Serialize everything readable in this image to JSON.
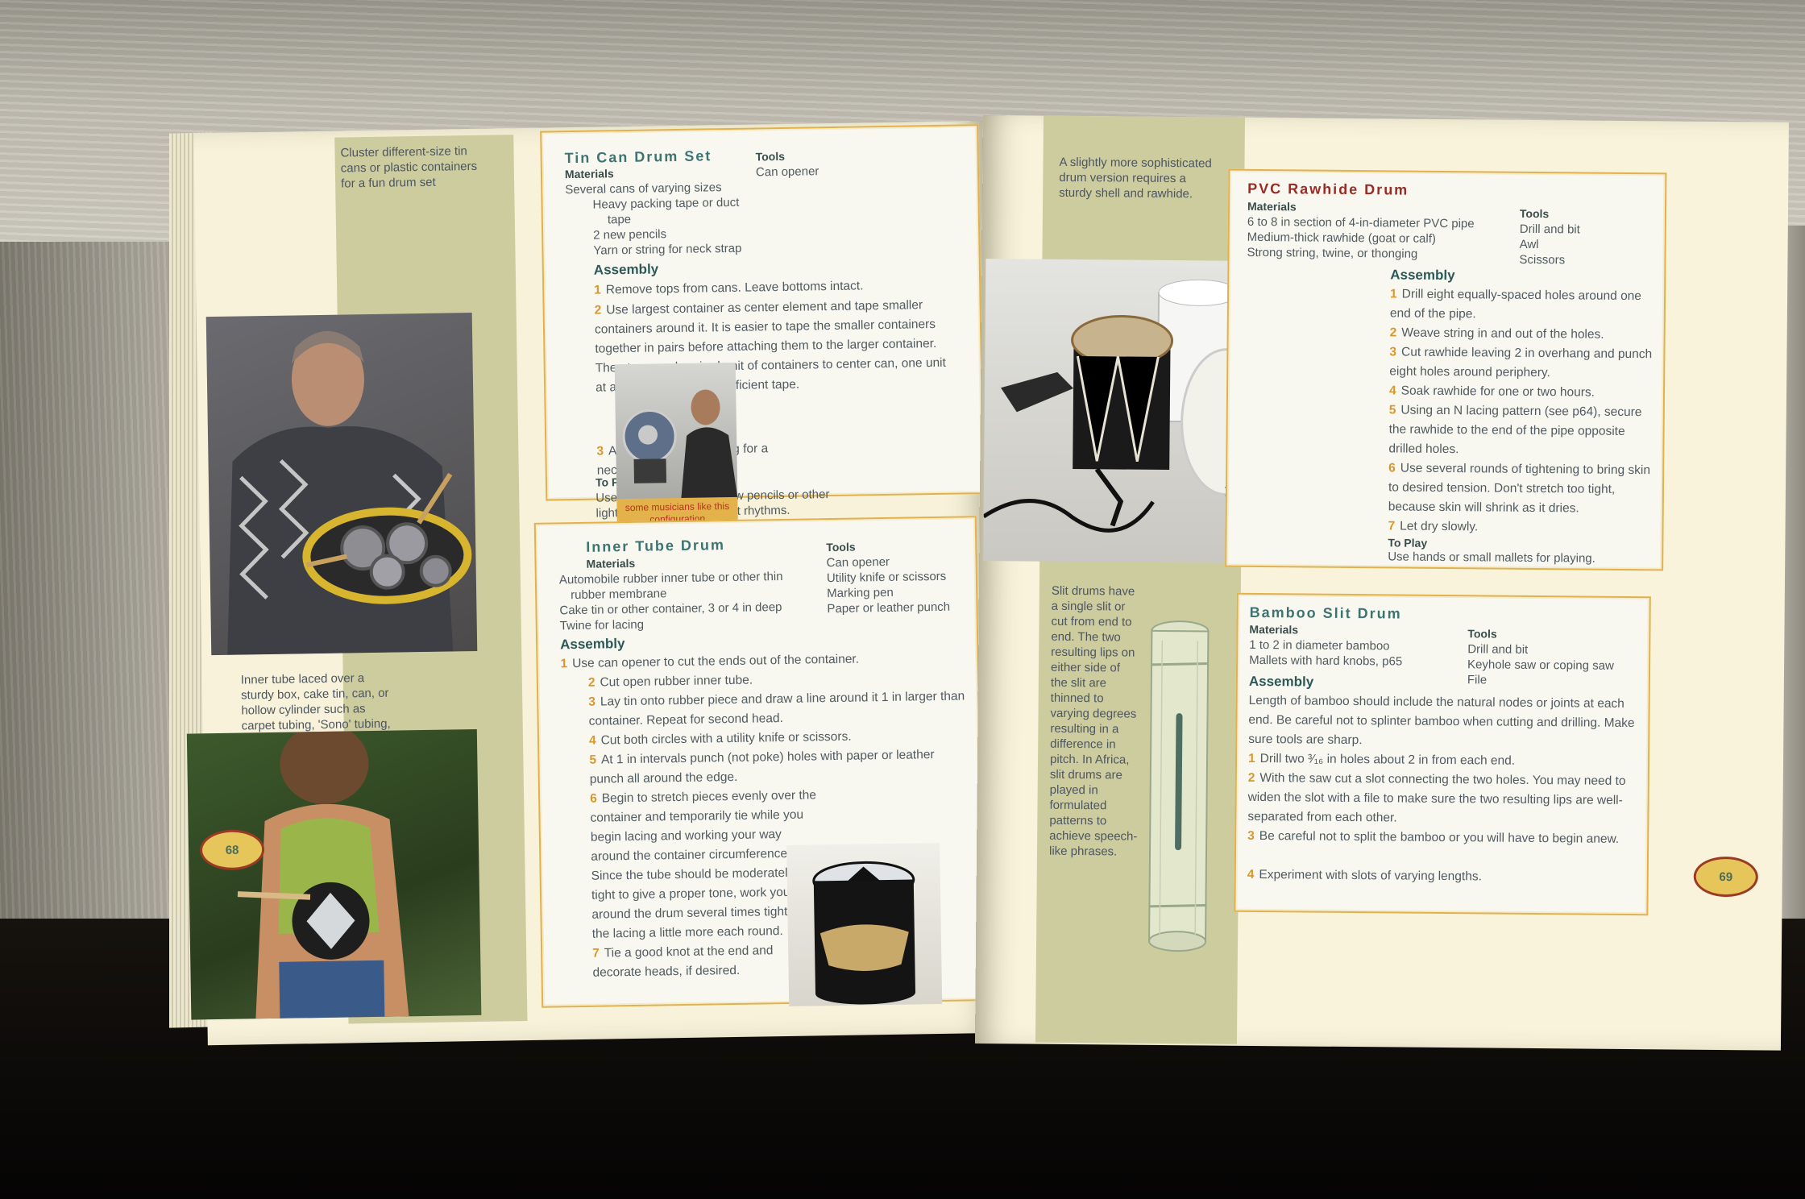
{
  "left_page": {
    "page_number": "68",
    "tin_can": {
      "caption": "Cluster different-size tin cans or plastic containers for a fun drum set",
      "title": "Tin Can Drum Set",
      "materials_label": "Materials",
      "materials": [
        "Several cans of varying sizes",
        "Heavy packing tape or duct",
        "tape",
        "2 new pencils",
        "Yarn or string for neck strap"
      ],
      "tools_label": "Tools",
      "tools": [
        "Can opener"
      ],
      "assembly_label": "Assembly",
      "steps": [
        {
          "n": "1",
          "text": "Remove tops from cans. Leave bottoms intact."
        },
        {
          "n": "2",
          "text": "Use largest container as center element and tape smaller containers around it. It is easier to tape the smaller containers together in pairs before attaching them to the larger container. Then tape each paired unit of containers to center can, one unit at a time. Secure with sufficient tape."
        },
        {
          "n": "3",
          "text": "Attach a length of string for a neck strap."
        }
      ],
      "to_play_label": "To Play",
      "to_play": "Use the eraser ends of new pencils or other lightweight sticks to tap out rhythms.",
      "photo_caption": "some musicians like this configuration"
    },
    "inner_tube": {
      "caption": "Inner tube laced over a sturdy box, cake tin, can, or hollow cylinder such as carpet tubing, 'Sono' tubing, large diameter pipes, or hollow logs make an effective drum.",
      "title": "Inner Tube Drum",
      "materials_label": "Materials",
      "materials": [
        "Automobile rubber inner tube or other thin",
        "rubber membrane",
        "Cake tin or other container, 3 or 4 in deep",
        "Twine for lacing"
      ],
      "tools_label": "Tools",
      "tools": [
        "Can opener",
        "Utility knife or scissors",
        "Marking pen",
        "Paper or leather punch"
      ],
      "assembly_label": "Assembly",
      "steps": [
        {
          "n": "1",
          "text": "Use can opener to cut the ends out of the container."
        },
        {
          "n": "2",
          "text": "Cut open rubber inner tube."
        },
        {
          "n": "3",
          "text": "Lay tin onto rubber piece and draw a line around it 1 in larger than container. Repeat for second head."
        },
        {
          "n": "4",
          "text": "Cut both circles with a utility knife or scissors."
        },
        {
          "n": "5",
          "text": "At 1 in intervals punch (not poke) holes with paper or leather punch all around the edge."
        },
        {
          "n": "6",
          "text": "Begin to stretch pieces evenly over the container and temporarily tie while you begin lacing and working your way around the container circumference. Since the tube should be moderately tight to give a proper tone, work your way around the drum several times tightening the lacing a little more each round."
        },
        {
          "n": "7",
          "text": "Tie a good knot at the end and decorate heads, if desired."
        }
      ]
    }
  },
  "right_page": {
    "page_number": "69",
    "pvc": {
      "caption": "A slightly more sophisticated drum version requires a sturdy shell and rawhide.",
      "title": "PVC Rawhide Drum",
      "materials_label": "Materials",
      "materials": [
        "6 to 8 in section of 4-in-diameter PVC pipe",
        "Medium-thick rawhide (goat or calf)",
        "Strong string, twine, or thonging"
      ],
      "tools_label": "Tools",
      "tools": [
        "Drill and bit",
        "Awl",
        "Scissors"
      ],
      "assembly_label": "Assembly",
      "steps": [
        {
          "n": "1",
          "text": "Drill eight equally-spaced holes around one end of the pipe."
        },
        {
          "n": "2",
          "text": "Weave string in and out of the holes."
        },
        {
          "n": "3",
          "text": "Cut rawhide leaving 2 in overhang and punch eight holes around periphery."
        },
        {
          "n": "4",
          "text": "Soak rawhide for one or two hours."
        },
        {
          "n": "5",
          "text": "Using an N lacing pattern (see p64), secure the rawhide to the end of the pipe opposite drilled holes."
        },
        {
          "n": "6",
          "text": "Use several rounds of tightening to bring skin to desired tension. Don't stretch too tight, because skin will shrink as it dries."
        },
        {
          "n": "7",
          "text": "Let dry slowly."
        }
      ],
      "to_play_label": "To Play",
      "to_play": "Use hands or small mallets for playing."
    },
    "bamboo": {
      "caption": "Slit drums have a single slit or cut from end to end. The two resulting lips on either side of the slit are thinned to varying degrees resulting in a difference in pitch. In Africa, slit drums are played in formulated patterns to achieve speech-like phrases.",
      "title": "Bamboo Slit Drum",
      "materials_label": "Materials",
      "materials": [
        "1 to 2 in diameter bamboo",
        "Mallets with hard knobs, p65"
      ],
      "tools_label": "Tools",
      "tools": [
        "Drill and bit",
        "Keyhole saw or coping saw",
        "File"
      ],
      "assembly_label": "Assembly",
      "intro": "Length of bamboo should include the natural nodes or joints at each end. Be careful not to splinter bamboo when cutting and drilling. Make sure tools are sharp.",
      "steps": [
        {
          "n": "1",
          "text": "Drill two ³⁄₁₆ in holes about 2 in from each end."
        },
        {
          "n": "2",
          "text": "With the saw cut a slot connecting the two holes. You may need to widen the slot with a file to make sure the two resulting lips are well-separated from each other."
        },
        {
          "n": "3",
          "text": "Be careful not to split the bamboo or you will have to begin anew."
        },
        {
          "n": "4",
          "text": "Experiment with slots of varying lengths."
        }
      ]
    }
  }
}
